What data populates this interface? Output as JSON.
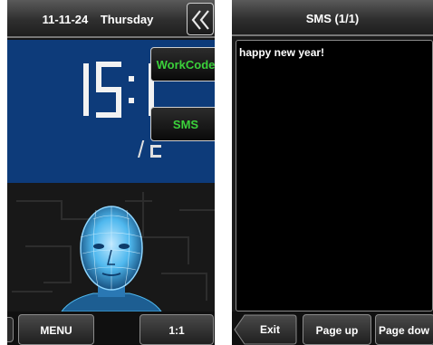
{
  "attendance_screen": {
    "date": "11-11-24",
    "weekday": "Thursday",
    "clock_visible_text": "15:1",
    "overlay_buttons": {
      "workcode_label": "WorkCode",
      "sms_label": "SMS"
    },
    "bottom_bar": {
      "menu_label": "MENU",
      "ratio_label": "1:1"
    }
  },
  "sms_screen": {
    "title": "SMS  (1/1)",
    "message": "happy new year!",
    "bottom_bar": {
      "exit_label": "Exit",
      "page_up_label": "Page up",
      "page_down_label": "Page dow"
    }
  },
  "colors": {
    "clock_panel_bg": "#0d3b7a",
    "button_text_green": "#3bd13b",
    "face_glow": "#4fb8ee",
    "header_gradient_top": "#5a5a5a",
    "header_gradient_bottom": "#1e1e1e"
  },
  "icons": {
    "collapse": "double-chevron-left-icon",
    "face": "face-scan-icon",
    "exit_arrow": "left-arrow-tab-icon"
  }
}
